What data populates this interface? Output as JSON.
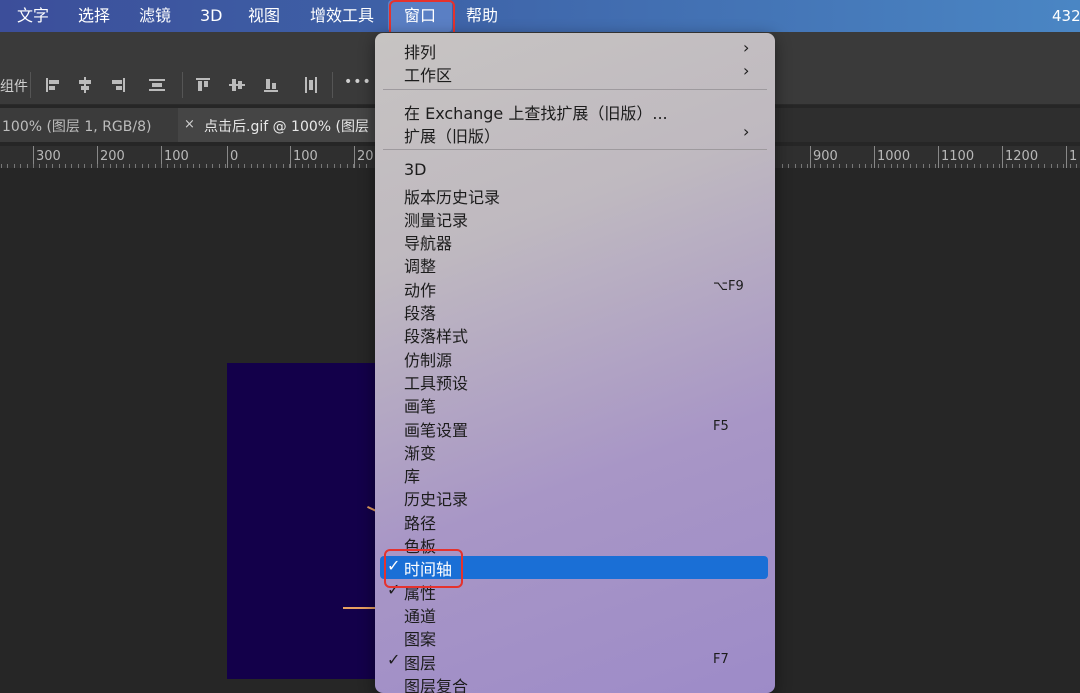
{
  "menubar": {
    "items": [
      "文字",
      "选择",
      "滤镜",
      "3D",
      "视图",
      "增效工具",
      "窗口",
      "帮助"
    ],
    "right_text": "432"
  },
  "options_bar": {
    "left_label": "组件",
    "more": "•••"
  },
  "tabs": [
    {
      "title": "100% (图层 1, RGB/8)",
      "close": "×"
    },
    {
      "title": "点击后.gif @ 100% (图层",
      "close": "×"
    }
  ],
  "ruler": {
    "left_ticks": [
      "300",
      "200",
      "100",
      "0",
      "100",
      "20"
    ],
    "right_ticks": [
      "900",
      "1000",
      "1100",
      "1200",
      "1"
    ]
  },
  "window_menu": {
    "items": [
      {
        "label": "排列",
        "submenu": true
      },
      {
        "label": "工作区",
        "submenu": true
      },
      {
        "divider": true
      },
      {
        "label": "在 Exchange 上查找扩展（旧版）..."
      },
      {
        "label": "扩展（旧版）",
        "submenu": true
      },
      {
        "divider": true
      },
      {
        "label": "3D"
      },
      {
        "label": "版本历史记录"
      },
      {
        "label": "测量记录"
      },
      {
        "label": "导航器"
      },
      {
        "label": "调整"
      },
      {
        "label": "动作",
        "shortcut": "⌥F9"
      },
      {
        "label": "段落"
      },
      {
        "label": "段落样式"
      },
      {
        "label": "仿制源"
      },
      {
        "label": "工具预设"
      },
      {
        "label": "画笔"
      },
      {
        "label": "画笔设置",
        "shortcut": "F5"
      },
      {
        "label": "渐变"
      },
      {
        "label": "库"
      },
      {
        "label": "历史记录"
      },
      {
        "label": "路径"
      },
      {
        "label": "色板"
      },
      {
        "label": "时间轴",
        "checked": true,
        "highlighted": true
      },
      {
        "label": "属性",
        "checked": true
      },
      {
        "label": "通道"
      },
      {
        "label": "图案"
      },
      {
        "label": "图层",
        "checked": true,
        "shortcut": "F7"
      },
      {
        "label": "图层复合"
      }
    ],
    "check_glyph": "✓",
    "arrow_glyph": "›"
  },
  "colors": {
    "menubar": "#3e63a8",
    "highlight": "#1a6fd6",
    "annotation": "#e5322d",
    "artboard": "#13004a"
  }
}
